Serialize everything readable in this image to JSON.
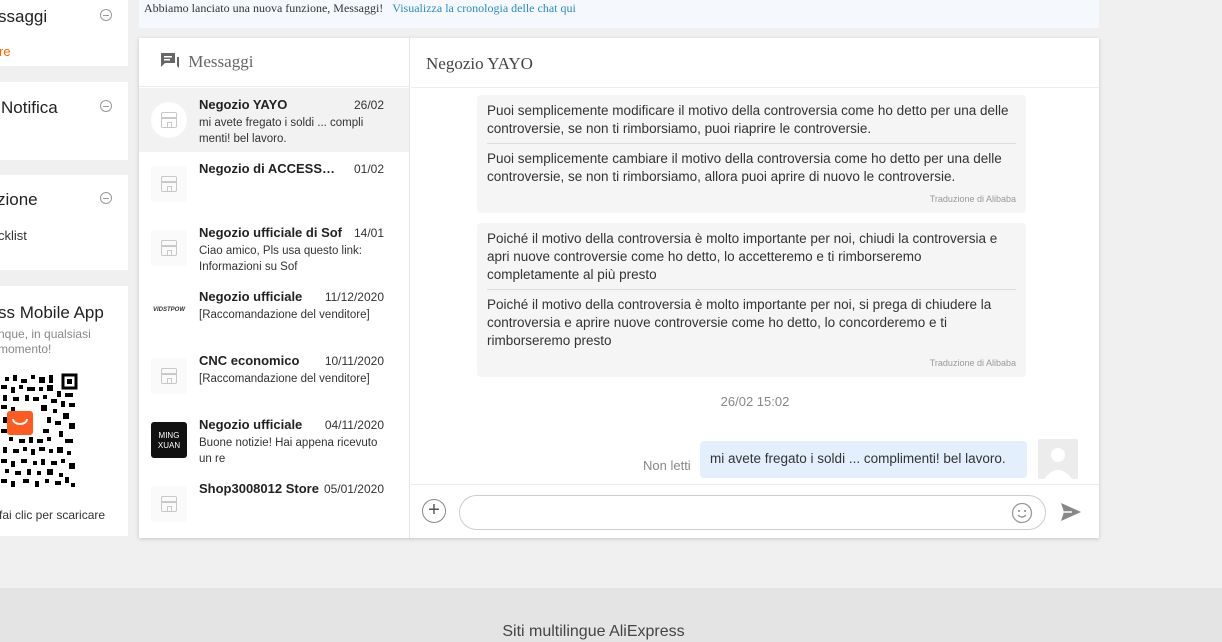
{
  "sidebar": {
    "messages": {
      "title": "ssaggi",
      "link": "re"
    },
    "notification": {
      "title": "Notifica"
    },
    "settings": {
      "title": "zione",
      "link": "cklist"
    },
    "app": {
      "title": "ss Mobile App",
      "desc": "nque, in qualsiasi momento!",
      "hint": "fai clic per scaricare"
    }
  },
  "notice": {
    "text": "Abbiamo lanciato una nuova funzione, Messaggi!",
    "link": "Visualizza la cronologia delle chat qui"
  },
  "conversations": {
    "title": "Messaggi",
    "items": [
      {
        "name": "Negozio YAYO",
        "date": "26/02",
        "preview": "mi avete fregato i soldi ... compli menti! bel lavoro."
      },
      {
        "name": "Negozio di ACCESSORI",
        "date": "01/02",
        "preview": ""
      },
      {
        "name": "Negozio ufficiale di Sof",
        "date": "14/01",
        "preview": "Ciao amico, Pls usa questo link: Informazioni su Sof"
      },
      {
        "name": "Negozio ufficiale",
        "date": "11/12/2020",
        "preview": "[Raccomandazione del venditore]",
        "logo": "VIDSTPOW"
      },
      {
        "name": "CNC economico",
        "date": "10/11/2020",
        "preview": "[Raccomandazione del venditore]"
      },
      {
        "name": "Negozio ufficiale",
        "date": "04/11/2020",
        "preview": "Buone notizie! Hai appena ricevuto un re",
        "logo1": "MING",
        "logo2": "XUAN"
      },
      {
        "name": "Shop3008012 Store",
        "date": "05/01/2020",
        "preview": ""
      }
    ]
  },
  "thread": {
    "title": "Negozio YAYO",
    "messages": [
      {
        "original": "Puoi semplicemente modificare il motivo della controversia come ho detto per una delle controversie, se non ti rimborsiamo, puoi riaprire le controversie.",
        "translation": "Puoi semplicemente cambiare il motivo della controversia come ho detto per una delle controversie, se non ti rimborsiamo, allora puoi aprire di nuovo le controversie.",
        "label": "Traduzione di Alibaba"
      },
      {
        "original": "Poiché il motivo della controversia è molto importante per noi, chiudi la controversia e apri nuove controversie come ho detto, lo accetteremo e ti rimborseremo completamente al più presto",
        "translation": "Poiché il motivo della controversia è molto importante per noi, si prega di chiudere la controversia e aprire nuove controversie come ho detto, lo concorderemo e ti rimborseremo presto",
        "label": "Traduzione di Alibaba"
      }
    ],
    "time": "26/02 15:02",
    "unread_label": "Non letti",
    "my_message": "mi avete fregato i soldi ... complimenti! bel lavoro.",
    "input_placeholder": ""
  },
  "footer": {
    "text": "Siti multilingue AliExpress"
  },
  "colors": {
    "accent": "#ff6a00",
    "link": "#2c8bc4",
    "my_bubble": "#e3effc"
  }
}
